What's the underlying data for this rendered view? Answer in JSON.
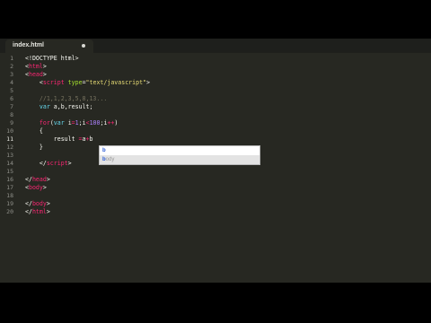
{
  "tab": {
    "title": "index.html",
    "modified_indicator": "dot"
  },
  "colors": {
    "background": "#272822",
    "tag": "#f92672",
    "attribute": "#a6e22e",
    "string": "#e6db74",
    "number": "#ae81ff",
    "keyword_storage": "#66d9ef",
    "comment": "#75715e",
    "text": "#f8f8f2"
  },
  "lines": [
    {
      "n": "1",
      "tokens": [
        {
          "t": "<!DOCTYPE html>",
          "c": "text"
        }
      ]
    },
    {
      "n": "2",
      "tokens": [
        {
          "t": "<",
          "c": "text"
        },
        {
          "t": "html",
          "c": "tag"
        },
        {
          "t": ">",
          "c": "text"
        }
      ]
    },
    {
      "n": "3",
      "tokens": [
        {
          "t": "<",
          "c": "text"
        },
        {
          "t": "head",
          "c": "tag"
        },
        {
          "t": ">",
          "c": "text"
        }
      ]
    },
    {
      "n": "4",
      "tokens": [
        {
          "t": "    <",
          "c": "text"
        },
        {
          "t": "script",
          "c": "tag"
        },
        {
          "t": " ",
          "c": "text"
        },
        {
          "t": "type",
          "c": "attribute"
        },
        {
          "t": "=",
          "c": "text"
        },
        {
          "t": "\"text/javascript\"",
          "c": "string"
        },
        {
          "t": ">",
          "c": "text"
        }
      ]
    },
    {
      "n": "5",
      "tokens": []
    },
    {
      "n": "6",
      "tokens": [
        {
          "t": "    //1,1,2,3,5,8,13...",
          "c": "comment"
        }
      ]
    },
    {
      "n": "7",
      "tokens": [
        {
          "t": "    ",
          "c": "text"
        },
        {
          "t": "var",
          "c": "keyword_storage"
        },
        {
          "t": " a,b,result;",
          "c": "text"
        }
      ]
    },
    {
      "n": "8",
      "tokens": []
    },
    {
      "n": "9",
      "tokens": [
        {
          "t": "    ",
          "c": "text"
        },
        {
          "t": "for",
          "c": "tag"
        },
        {
          "t": "(",
          "c": "text"
        },
        {
          "t": "var",
          "c": "keyword_storage"
        },
        {
          "t": " i",
          "c": "text"
        },
        {
          "t": "=",
          "c": "tag"
        },
        {
          "t": "1",
          "c": "number"
        },
        {
          "t": ";i",
          "c": "text"
        },
        {
          "t": "<",
          "c": "tag"
        },
        {
          "t": "100",
          "c": "number"
        },
        {
          "t": ";i",
          "c": "text"
        },
        {
          "t": "++",
          "c": "tag"
        },
        {
          "t": ")",
          "c": "text"
        }
      ]
    },
    {
      "n": "10",
      "tokens": [
        {
          "t": "    {",
          "c": "text"
        }
      ]
    },
    {
      "n": "11",
      "active": true,
      "tokens": [
        {
          "t": "        result ",
          "c": "text"
        },
        {
          "t": "=",
          "c": "tag"
        },
        {
          "t": "a",
          "c": "text"
        },
        {
          "t": "+",
          "c": "tag"
        },
        {
          "t": "b",
          "c": "text"
        }
      ]
    },
    {
      "n": "12",
      "tokens": [
        {
          "t": "    }",
          "c": "text"
        }
      ]
    },
    {
      "n": "13",
      "tokens": []
    },
    {
      "n": "14",
      "tokens": [
        {
          "t": "    </",
          "c": "text"
        },
        {
          "t": "script",
          "c": "tag"
        },
        {
          "t": ">",
          "c": "text"
        }
      ]
    },
    {
      "n": "15",
      "tokens": []
    },
    {
      "n": "16",
      "tokens": [
        {
          "t": "</",
          "c": "text"
        },
        {
          "t": "head",
          "c": "tag"
        },
        {
          "t": ">",
          "c": "text"
        }
      ]
    },
    {
      "n": "17",
      "tokens": [
        {
          "t": "<",
          "c": "text"
        },
        {
          "t": "body",
          "c": "tag"
        },
        {
          "t": ">",
          "c": "text"
        }
      ]
    },
    {
      "n": "18",
      "tokens": []
    },
    {
      "n": "19",
      "tokens": [
        {
          "t": "</",
          "c": "text"
        },
        {
          "t": "body",
          "c": "tag"
        },
        {
          "t": ">",
          "c": "text"
        }
      ]
    },
    {
      "n": "20",
      "tokens": [
        {
          "t": "</",
          "c": "text"
        },
        {
          "t": "html",
          "c": "tag"
        },
        {
          "t": ">",
          "c": "text"
        }
      ]
    }
  ],
  "autocomplete": {
    "items": [
      {
        "match": "b",
        "rest": ""
      },
      {
        "match": "b",
        "rest": "ody"
      }
    ]
  }
}
